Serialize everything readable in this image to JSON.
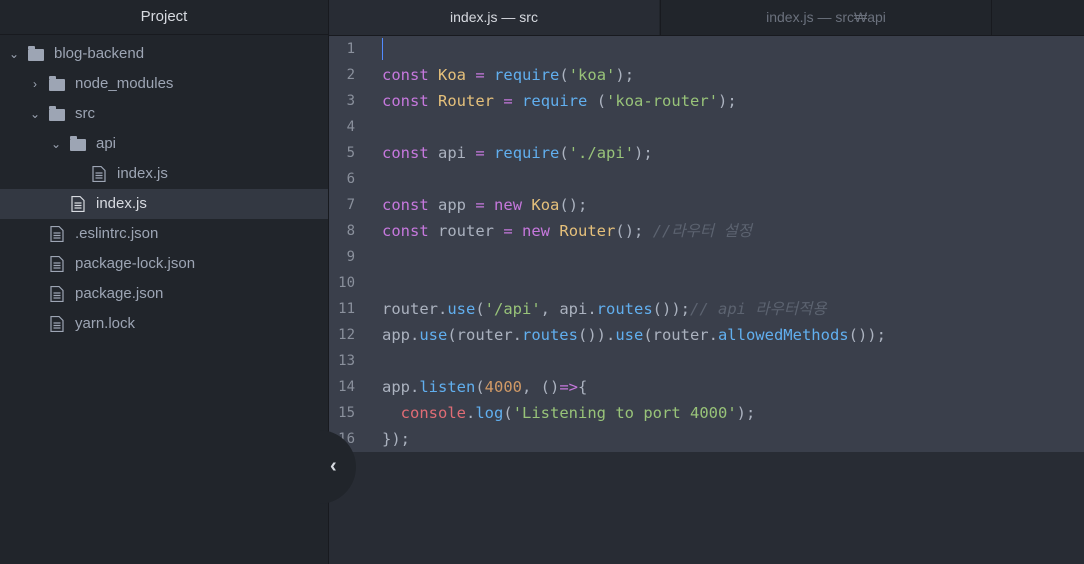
{
  "sidebar": {
    "title": "Project",
    "tree": [
      {
        "label": "blog-backend",
        "kind": "folder",
        "expanded": true
      },
      {
        "label": "node_modules",
        "kind": "folder",
        "expanded": false
      },
      {
        "label": "src",
        "kind": "folder",
        "expanded": true
      },
      {
        "label": "api",
        "kind": "folder",
        "expanded": true
      },
      {
        "label": "index.js",
        "kind": "file"
      },
      {
        "label": "index.js",
        "kind": "file",
        "selected": true
      },
      {
        "label": ".eslintrc.json",
        "kind": "file"
      },
      {
        "label": "package-lock.json",
        "kind": "file"
      },
      {
        "label": "package.json",
        "kind": "file"
      },
      {
        "label": "yarn.lock",
        "kind": "file"
      }
    ]
  },
  "tabs": [
    {
      "label": "index.js — src",
      "active": true
    },
    {
      "label": "index.js — src₩api",
      "active": false
    }
  ],
  "editor": {
    "line_numbers": [
      "1",
      "2",
      "3",
      "4",
      "5",
      "6",
      "7",
      "8",
      "9",
      "10",
      "11",
      "12",
      "13",
      "14",
      "15",
      "16"
    ]
  },
  "icons": {
    "chevron_down": "chevron-down-icon",
    "chevron_right": "chevron-right-icon",
    "folder": "folder-icon",
    "file": "file-text-icon",
    "collapse": "chevron-left-icon"
  },
  "colors": {
    "keyword": "#c678dd",
    "class": "#e5c07b",
    "string": "#98c379",
    "function": "#61afef",
    "number": "#d19a66",
    "comment": "#5c6370",
    "selection": "#3a3f4b",
    "cursor": "#528bff"
  }
}
